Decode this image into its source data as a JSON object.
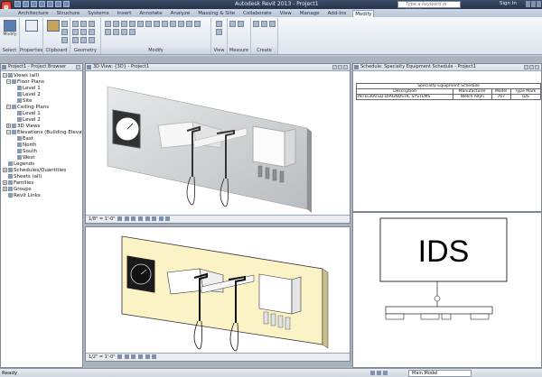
{
  "titlebar": {
    "app_menu_label": "R",
    "title": "Autodesk Revit 2013 - Project1",
    "search_placeholder": "Type a keyword or phrase",
    "sign_in": "Sign In"
  },
  "tabs": [
    {
      "label": "Architecture",
      "active": false
    },
    {
      "label": "Structure",
      "active": false
    },
    {
      "label": "Systems",
      "active": false
    },
    {
      "label": "Insert",
      "active": false
    },
    {
      "label": "Annotate",
      "active": false
    },
    {
      "label": "Analyze",
      "active": false
    },
    {
      "label": "Massing & Site",
      "active": false
    },
    {
      "label": "Collaborate",
      "active": false
    },
    {
      "label": "View",
      "active": false
    },
    {
      "label": "Manage",
      "active": false
    },
    {
      "label": "Add-Ins",
      "active": false
    },
    {
      "label": "Modify",
      "active": true
    }
  ],
  "ribbon": {
    "modify_button": "Modify",
    "properties_button": "",
    "groups": [
      "Select",
      "Properties",
      "Clipboard",
      "Geometry",
      "Modify",
      "View",
      "Measure",
      "Create"
    ]
  },
  "browser": {
    "title": "Project1 - Project Browser",
    "nodes": [
      {
        "label": "Views (all)",
        "toggle": "−"
      },
      {
        "label": "Floor Plans",
        "toggle": "−"
      },
      {
        "label": "Level 1",
        "toggle": ""
      },
      {
        "label": "Level 2",
        "toggle": ""
      },
      {
        "label": "Site",
        "toggle": ""
      },
      {
        "label": "Ceiling Plans",
        "toggle": "−"
      },
      {
        "label": "Level 1",
        "toggle": ""
      },
      {
        "label": "Level 2",
        "toggle": ""
      },
      {
        "label": "3D Views",
        "toggle": "+"
      },
      {
        "label": "Elevations (Building Elevation)",
        "toggle": "−"
      },
      {
        "label": "East",
        "toggle": ""
      },
      {
        "label": "North",
        "toggle": ""
      },
      {
        "label": "South",
        "toggle": ""
      },
      {
        "label": "West",
        "toggle": ""
      },
      {
        "label": "Legends",
        "toggle": ""
      },
      {
        "label": "Schedules/Quantities",
        "toggle": "+"
      },
      {
        "label": "Sheets (all)",
        "toggle": ""
      },
      {
        "label": "Families",
        "toggle": "+"
      },
      {
        "label": "Groups",
        "toggle": "+"
      },
      {
        "label": "Revit Links",
        "toggle": ""
      }
    ]
  },
  "views": {
    "view1_title": "3D View: {3D} - Project1",
    "view1_scale": "1/8\" = 1'-0\"",
    "view2_scale": "1/2\" = 1'-0\""
  },
  "schedule": {
    "title": "Schedule: Specialty Equipment Schedule - Project1",
    "header": "Specialty Equipment Schedule",
    "columns": [
      "Description",
      "Manufacturer",
      "Model",
      "Type Mark"
    ],
    "rows": [
      [
        "INTEGRATED DIAGNOSTIC SYSTEMS",
        "Welch Allyn",
        "767",
        "IDS"
      ]
    ]
  },
  "legend": {
    "label": "IDS"
  },
  "status": {
    "ready": "Ready",
    "model": "Main Model"
  }
}
